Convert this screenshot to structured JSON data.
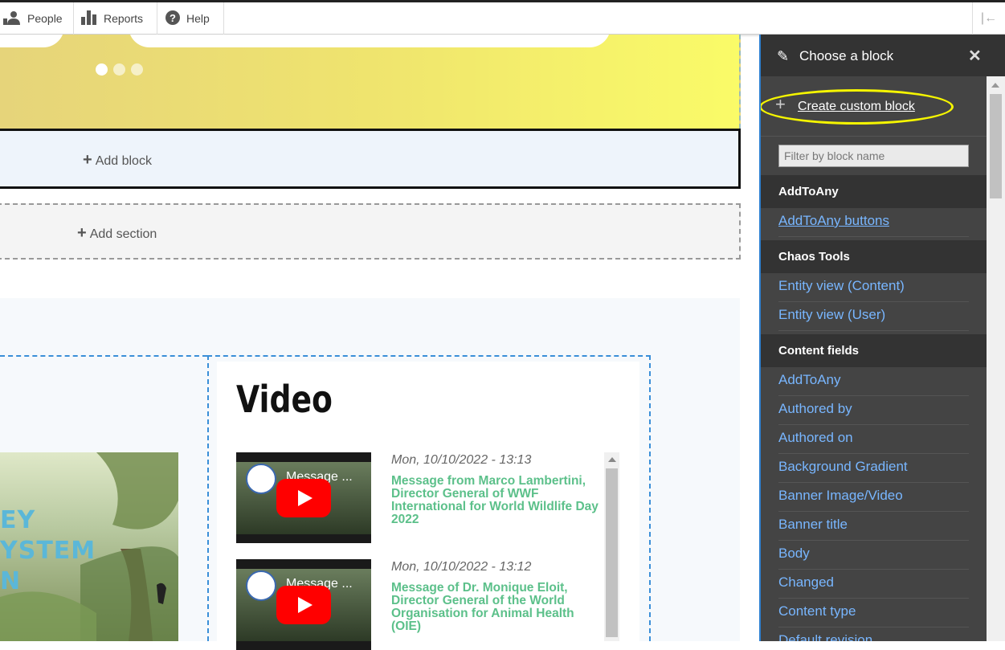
{
  "toolbar": {
    "people": "People",
    "reports": "Reports",
    "help": "Help"
  },
  "layout_builder": {
    "add_block": "Add block",
    "add_section": "Add section"
  },
  "video": {
    "heading": "Video",
    "items": [
      {
        "thumb_title": "Message ...",
        "date": "Mon, 10/10/2022 - 13:13",
        "title": "Message from Marco Lambertini, Director General of WWF International for World Wildlife Day 2022"
      },
      {
        "thumb_title": "Message ...",
        "date": "Mon, 10/10/2022 - 13:12",
        "title": "Message of Dr. Monique Eloit, Director General of the World Organisation for Animal Health (OIE)"
      }
    ]
  },
  "picture_text": [
    "EY",
    "YSTEM",
    "N"
  ],
  "panel": {
    "title": "Choose a block",
    "create_custom": "Create custom block",
    "filter_placeholder": "Filter by block name",
    "categories": [
      {
        "name": "AddToAny",
        "items": [
          "AddToAny buttons"
        ]
      },
      {
        "name": "Chaos Tools",
        "items": [
          "Entity view (Content)",
          "Entity view (User)"
        ]
      },
      {
        "name": "Content fields",
        "items": [
          "AddToAny",
          "Authored by",
          "Authored on",
          "Background Gradient",
          "Banner Image/Video",
          "Banner title",
          "Body",
          "Changed",
          "Content type",
          "Default revision"
        ]
      }
    ]
  },
  "colors": {
    "accent_blue": "#2f80d0",
    "panel_link": "#78b6ff",
    "video_link": "#5cc08a",
    "highlight": "#f5f500"
  }
}
